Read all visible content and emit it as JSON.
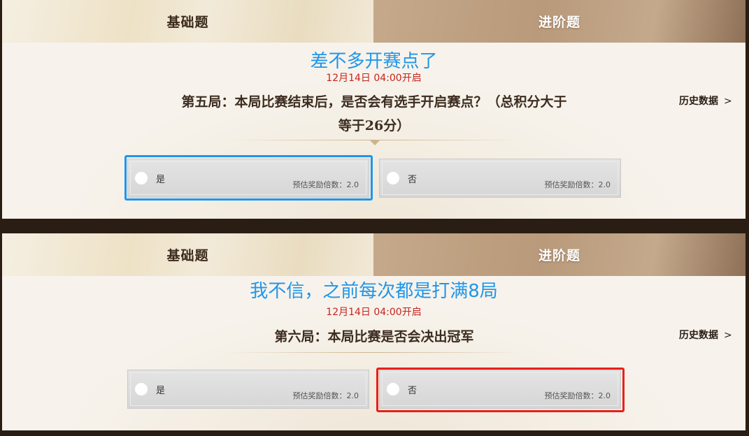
{
  "panels": [
    {
      "tabs": {
        "basic": "基础题",
        "advanced": "进阶题"
      },
      "annotation": "差不多开赛点了",
      "time": "12月14日 04:00开启",
      "question": "第五局：本局比赛结束后，是否会有选手开启赛点？（总积分大于等于26分）",
      "history": "历史数据",
      "options": [
        {
          "label": "是",
          "multiplier": "预估奖励倍数：2.0"
        },
        {
          "label": "否",
          "multiplier": "预估奖励倍数：2.0"
        }
      ],
      "highlight": "是"
    },
    {
      "tabs": {
        "basic": "基础题",
        "advanced": "进阶题"
      },
      "annotation": "我不信，之前每次都是打满8局",
      "time": "12月14日 04:00开启",
      "question": "第六局：本局比赛是否会决出冠军",
      "history": "历史数据",
      "options": [
        {
          "label": "是",
          "multiplier": "预估奖励倍数：2.0"
        },
        {
          "label": "否",
          "multiplier": "预估奖励倍数：2.0"
        }
      ],
      "highlight": "否"
    }
  ],
  "icons": {
    "history_chevron": "chevron-right-icon",
    "option_radio": "radio-icon"
  },
  "colors": {
    "annotation": "#2196e8",
    "time": "#c8231e",
    "highlight_blue": "#1e96ee",
    "highlight_red": "#e8201a"
  }
}
